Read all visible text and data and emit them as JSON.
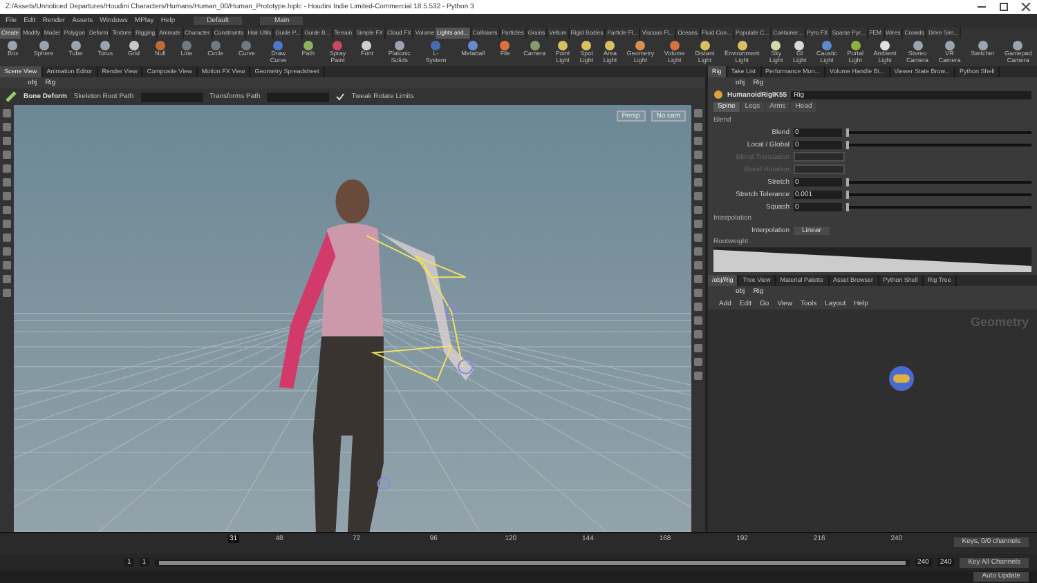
{
  "window": {
    "title": "Z:/Assets/Unnoticed Departures/Houdini Characters/Humans/Human_00/Human_Prototype.hiplc - Houdini Indie Limited-Commercial 18.5.532 - Python 3"
  },
  "menu": {
    "items": [
      "File",
      "Edit",
      "Render",
      "Assets",
      "Windows",
      "MPlay",
      "Help"
    ],
    "desktop": "Default",
    "context": "Main"
  },
  "shelf_tabs_left": [
    {
      "label": "Create",
      "selected": true
    },
    {
      "label": "Modify",
      "selected": false
    },
    {
      "label": "Model",
      "selected": false
    },
    {
      "label": "Polygon",
      "selected": false
    },
    {
      "label": "Deform",
      "selected": false
    },
    {
      "label": "Texture",
      "selected": false
    },
    {
      "label": "Rigging",
      "selected": false
    },
    {
      "label": "Animate",
      "selected": false
    },
    {
      "label": "Character",
      "selected": false
    },
    {
      "label": "Constraints",
      "selected": false
    },
    {
      "label": "Hair Utils",
      "selected": false
    },
    {
      "label": "Guide P...",
      "selected": false
    },
    {
      "label": "Guide B...",
      "selected": false
    },
    {
      "label": "Terrain",
      "selected": false
    },
    {
      "label": "Simple FX",
      "selected": false
    },
    {
      "label": "Cloud FX",
      "selected": false
    },
    {
      "label": "Volume",
      "selected": false
    }
  ],
  "shelf_tabs_right": [
    {
      "label": "Lights and...",
      "selected": true
    },
    {
      "label": "Collisions",
      "selected": false
    },
    {
      "label": "Particles",
      "selected": false
    },
    {
      "label": "Grains",
      "selected": false
    },
    {
      "label": "Vellum",
      "selected": false
    },
    {
      "label": "Rigid Bodies",
      "selected": false
    },
    {
      "label": "Particle Fl...",
      "selected": false
    },
    {
      "label": "Viscous Fl...",
      "selected": false
    },
    {
      "label": "Oceans",
      "selected": false
    },
    {
      "label": "Fluid Con...",
      "selected": false
    },
    {
      "label": "Populate C...",
      "selected": false
    },
    {
      "label": "Container...",
      "selected": false
    },
    {
      "label": "Pyro FX",
      "selected": false
    },
    {
      "label": "Sparse Pyr...",
      "selected": false
    },
    {
      "label": "FEM",
      "selected": false
    },
    {
      "label": "Wires",
      "selected": false
    },
    {
      "label": "Crowds",
      "selected": false
    },
    {
      "label": "Drive Sim...",
      "selected": false
    }
  ],
  "shelf_tools_left": [
    {
      "label": "Box",
      "color": "#9aa4b0"
    },
    {
      "label": "Sphere",
      "color": "#9aa4b0"
    },
    {
      "label": "Tube",
      "color": "#9aa4b0"
    },
    {
      "label": "Torus",
      "color": "#9aa4b0"
    },
    {
      "label": "Grid",
      "color": "#c8c8c8"
    },
    {
      "label": "Null",
      "color": "#c06a3a"
    },
    {
      "label": "Line",
      "color": "#707a80"
    },
    {
      "label": "Circle",
      "color": "#707a80"
    },
    {
      "label": "Curve",
      "color": "#707a80"
    },
    {
      "label": "Draw Curve",
      "color": "#4a7ac8"
    },
    {
      "label": "Path",
      "color": "#8ab060"
    },
    {
      "label": "Spray Paint",
      "color": "#c84a5a"
    },
    {
      "label": "Font",
      "color": "#d0d0d0"
    },
    {
      "label": "Platonic Solids",
      "color": "#9aa4b0"
    },
    {
      "label": "L-System",
      "color": "#4a6ab0"
    },
    {
      "label": "Metaball",
      "color": "#6a8ad0"
    },
    {
      "label": "File",
      "color": "#e0703a"
    }
  ],
  "shelf_tools_right": [
    {
      "label": "Camera",
      "color": "#8a9a70"
    },
    {
      "label": "Point Light",
      "color": "#d8c060"
    },
    {
      "label": "Spot Light",
      "color": "#d8c060"
    },
    {
      "label": "Area Light",
      "color": "#d8c060"
    },
    {
      "label": "Geometry Light",
      "color": "#d89050"
    },
    {
      "label": "Volume Light",
      "color": "#d87040"
    },
    {
      "label": "Distant Light",
      "color": "#d8c060"
    },
    {
      "label": "Environment Light",
      "color": "#d8c060"
    },
    {
      "label": "Sky Light",
      "color": "#d8d8b0"
    },
    {
      "label": "GI Light",
      "color": "#d8d8d8"
    },
    {
      "label": "Caustic Light",
      "color": "#5a8ad0"
    },
    {
      "label": "Portal Light",
      "color": "#8ab040"
    },
    {
      "label": "Ambient Light",
      "color": "#e0e0e0"
    },
    {
      "label": "Stereo Camera",
      "color": "#9aa4b0"
    },
    {
      "label": "VR Camera",
      "color": "#9aa4b0"
    },
    {
      "label": "Switcher",
      "color": "#9aa4b0"
    },
    {
      "label": "Gamepad Camera",
      "color": "#9aa4b0"
    }
  ],
  "pane_tabs_left": [
    {
      "label": "Scene View",
      "selected": true
    },
    {
      "label": "Animation Editor",
      "selected": false
    },
    {
      "label": "Render View",
      "selected": false
    },
    {
      "label": "Composite View",
      "selected": false
    },
    {
      "label": "Motion FX View",
      "selected": false
    },
    {
      "label": "Geometry Spreadsheet",
      "selected": false
    }
  ],
  "pane_tabs_right": [
    {
      "label": "Rig",
      "selected": true
    },
    {
      "label": "Take List",
      "selected": false
    },
    {
      "label": "Performance Mon...",
      "selected": false
    },
    {
      "label": "Volume Handle Bi...",
      "selected": false
    },
    {
      "label": "Viewer State Brow...",
      "selected": false
    },
    {
      "label": "Python Shell",
      "selected": false
    }
  ],
  "viewer_path": [
    "obj",
    "Rig"
  ],
  "tool_options": {
    "tool": "Bone Deform",
    "skeleton_label": "Skeleton Root Path",
    "transforms_label": "Transforms Path",
    "tweak_label": "Tweak Rotate Limits",
    "tweak_checked": true
  },
  "viewport": {
    "camera": "Persp",
    "cam_menu": "No cam"
  },
  "params_path": [
    "obj",
    "Rig"
  ],
  "node": {
    "type": "HumanoidRigIK55",
    "name": "Rig"
  },
  "param_tabs": [
    {
      "label": "Spine",
      "selected": true
    },
    {
      "label": "Legs",
      "selected": false
    },
    {
      "label": "Arms",
      "selected": false
    },
    {
      "label": "Head",
      "selected": false
    }
  ],
  "params": [
    {
      "kind": "header",
      "label": "Blend"
    },
    {
      "kind": "slider",
      "label": "Blend",
      "value": "0",
      "level": 0,
      "disabled": false
    },
    {
      "kind": "slider",
      "label": "Local / Global",
      "value": "0",
      "level": 0,
      "disabled": false
    },
    {
      "kind": "slider",
      "label": "Blend Translation",
      "disabled": true
    },
    {
      "kind": "slider",
      "label": "Blend Rotation",
      "disabled": true
    },
    {
      "kind": "slider",
      "label": "Stretch",
      "value": "0",
      "level": 0,
      "disabled": false
    },
    {
      "kind": "slider",
      "label": "Stretch Tolerance",
      "value": "0.001",
      "level": 0,
      "disabled": false
    },
    {
      "kind": "slider",
      "label": "Squash",
      "value": "0",
      "level": 0,
      "disabled": false
    },
    {
      "kind": "header",
      "label": "Interpolation"
    },
    {
      "kind": "menu",
      "label": "Interpolation",
      "value": "Linear"
    },
    {
      "kind": "ramp",
      "label": "Rootweight"
    }
  ],
  "network": {
    "tabs": [
      {
        "label": "/obj/Rig",
        "selected": true
      },
      {
        "label": "Tree View",
        "selected": false
      },
      {
        "label": "Material Palette",
        "selected": false
      },
      {
        "label": "Asset Browser",
        "selected": false
      },
      {
        "label": "Python Shell",
        "selected": false
      },
      {
        "label": "Rig Tree",
        "selected": false
      }
    ],
    "path": [
      "obj",
      "Rig"
    ],
    "menu": [
      "Add",
      "Edit",
      "Go",
      "View",
      "Tools",
      "Layout",
      "Help"
    ],
    "context_label": "Geometry"
  },
  "timeline": {
    "frame": "31",
    "ticks": [
      "48",
      "72",
      "96",
      "120",
      "144",
      "168",
      "192",
      "216",
      "240"
    ],
    "keys_label": "Keys, 0/0 channels",
    "key_all": "Key All Channels"
  },
  "playbar": {
    "level": 1,
    "start": "1",
    "start2": "1",
    "end": "240",
    "end2": "240",
    "auto_update": "Auto Update"
  }
}
